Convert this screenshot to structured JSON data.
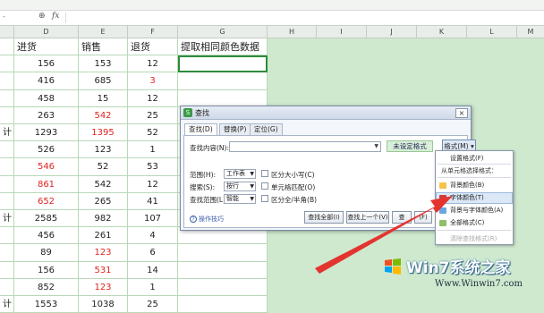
{
  "formula_bar": {
    "name_box": "-",
    "zoom_icon": "zoom-icon",
    "fx_label": "fx",
    "value": ""
  },
  "column_headers": [
    "D",
    "E",
    "F",
    "G",
    "H",
    "I",
    "J",
    "K",
    "L",
    "M"
  ],
  "table": {
    "headers": [
      "进货",
      "销售",
      "退货",
      "提取相同颜色数据"
    ],
    "row_labels": [
      "",
      "",
      "",
      "",
      "计",
      "",
      "",
      "",
      "",
      "计",
      "",
      "",
      "",
      "",
      "计"
    ],
    "rows": [
      {
        "d": "156",
        "e": "153",
        "f": "12",
        "e_red": false,
        "f_red": false,
        "d_red": false
      },
      {
        "d": "416",
        "e": "685",
        "f": "3",
        "e_red": false,
        "f_red": true,
        "d_red": false
      },
      {
        "d": "458",
        "e": "15",
        "f": "12",
        "e_red": false,
        "f_red": false,
        "d_red": false
      },
      {
        "d": "263",
        "e": "542",
        "f": "25",
        "e_red": true,
        "f_red": false,
        "d_red": false
      },
      {
        "d": "1293",
        "e": "1395",
        "f": "52",
        "e_red": true,
        "f_red": false,
        "d_red": false
      },
      {
        "d": "526",
        "e": "123",
        "f": "1",
        "e_red": false,
        "f_red": false,
        "d_red": false
      },
      {
        "d": "546",
        "e": "52",
        "f": "53",
        "e_red": false,
        "f_red": false,
        "d_red": true
      },
      {
        "d": "861",
        "e": "542",
        "f": "12",
        "e_red": false,
        "f_red": false,
        "d_red": true
      },
      {
        "d": "652",
        "e": "265",
        "f": "41",
        "e_red": false,
        "f_red": false,
        "d_red": true
      },
      {
        "d": "2585",
        "e": "982",
        "f": "107",
        "e_red": false,
        "f_red": false,
        "d_red": false
      },
      {
        "d": "456",
        "e": "261",
        "f": "4",
        "e_red": false,
        "f_red": false,
        "d_red": false
      },
      {
        "d": "89",
        "e": "123",
        "f": "6",
        "e_red": true,
        "f_red": false,
        "d_red": false
      },
      {
        "d": "156",
        "e": "531",
        "f": "14",
        "e_red": true,
        "f_red": false,
        "d_red": false
      },
      {
        "d": "852",
        "e": "123",
        "f": "1",
        "e_red": true,
        "f_red": false,
        "d_red": false
      },
      {
        "d": "1553",
        "e": "1038",
        "f": "25",
        "e_red": false,
        "f_red": false,
        "d_red": false
      }
    ]
  },
  "find_dialog": {
    "title": "查找",
    "close_label": "×",
    "tabs": [
      "查找(D)",
      "替换(P)",
      "定位(G)"
    ],
    "active_tab": 0,
    "find_label": "查找内容(N):",
    "find_value": "",
    "no_format_label": "未设定格式",
    "format_button": "格式(M) ▾",
    "scope_label": "范围(H):",
    "scope_value": "工作表",
    "search_label": "搜索(S):",
    "search_value": "按行",
    "lookin_label": "查找范围(L):",
    "lookin_value": "智能",
    "opt_case": "区分大小写(C)",
    "opt_cell": "单元格匹配(O)",
    "opt_width": "区分全/半角(B)",
    "btn_find_all": "查找全部(I)",
    "btn_prev": "查找上一个(V)",
    "btn_next": "查",
    "btn_close": "(F)",
    "tips": "操作技巧"
  },
  "format_menu": {
    "items": [
      {
        "label": "设置格式(F)",
        "kind": "normal",
        "icon": ""
      },
      {
        "label": "从单元格选择格式：",
        "kind": "header",
        "icon": ""
      },
      {
        "label": "背景颜色(B)",
        "kind": "normal",
        "icon": "fill-color-icon"
      },
      {
        "label": "字体颜色(T)",
        "kind": "highlight",
        "icon": "font-color-icon"
      },
      {
        "label": "背景与字体颜色(A)",
        "kind": "normal",
        "icon": "fill-font-color-icon"
      },
      {
        "label": "全部格式(C)",
        "kind": "normal",
        "icon": "all-format-icon"
      },
      {
        "label": "清除查找格式(R)",
        "kind": "disabled",
        "icon": ""
      }
    ]
  },
  "watermark": {
    "brand": "Win7系统之家",
    "url": "Www.Winwin7.com"
  },
  "colors": {
    "accent_red": "#e02424",
    "sheet_green": "#cfe9cf",
    "selection_green": "#2e8b3c",
    "arrow_red": "#e3342f"
  }
}
